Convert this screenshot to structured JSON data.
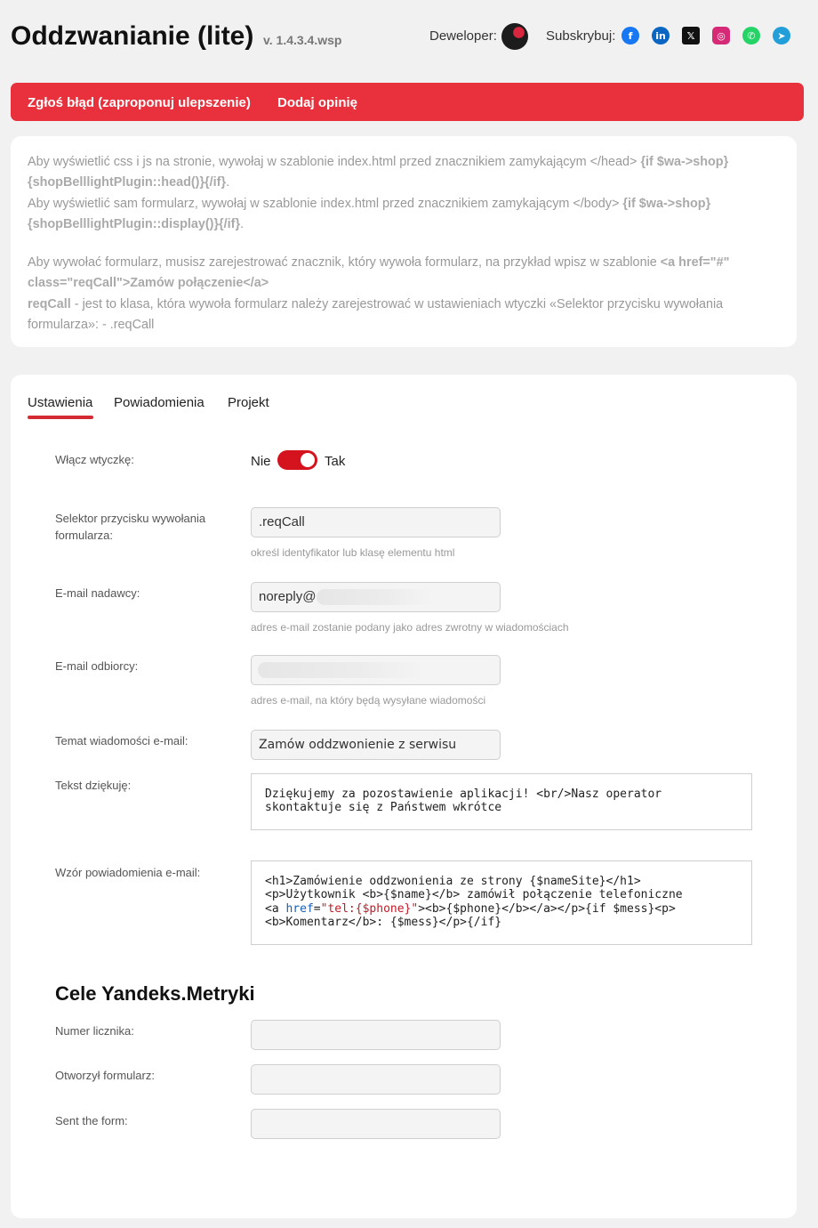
{
  "header": {
    "title": "Oddzwanianie (lite)",
    "version": "v. 1.4.3.4.wsp",
    "developer_label": "Deweloper:",
    "subscribe_label": "Subskrybuj:",
    "social": [
      {
        "name": "facebook-icon",
        "glyph": "f",
        "color": "#1877f2"
      },
      {
        "name": "linkedin-icon",
        "glyph": "in",
        "color": "#0a66c2"
      },
      {
        "name": "x-icon",
        "glyph": "𝕏",
        "color": "#111111"
      },
      {
        "name": "instagram-icon",
        "glyph": "◎",
        "color": "#d62976"
      },
      {
        "name": "whatsapp-icon",
        "glyph": "✆",
        "color": "#25d366"
      },
      {
        "name": "telegram-icon",
        "glyph": "➤",
        "color": "#229ed9"
      }
    ]
  },
  "actions": {
    "report_bug": "Zgłoś błąd (zaproponuj ulepszenie)",
    "add_review": "Dodaj opinię"
  },
  "info": {
    "line1_pre": "Aby wyświetlić css i js na stronie, wywołaj w szablonie index.html przed znacznikiem zamykającym </head> ",
    "line1_code": "{if $wa->shop}{shopBelllightPlugin::head()}{/if}",
    "line2_pre": "Aby wyświetlić sam formularz, wywołaj w szablonie index.html przed znacznikiem zamykającym </body> ",
    "line2_code": "{if $wa->shop}{shopBelllightPlugin::display()}{/if}",
    "line3_pre": "Aby wywołać formularz, musisz zarejestrować znacznik, który wywoła formularz, na przykład wpisz w szablonie ",
    "line3_code": "<a href=\"#\" class=\"reqCall\">Zamów połączenie</a>",
    "line4_code": "reqCall",
    "line4_post": " - jest to klasa, która wywoła formularz należy zarejestrować w ustawieniach wtyczki «Selektor przycisku wywołania formularza»: - .reqCall",
    "dot": "."
  },
  "tabs": [
    {
      "label": "Ustawienia",
      "active": true
    },
    {
      "label": "Powiadomienia",
      "active": false
    },
    {
      "label": "Projekt",
      "active": false
    }
  ],
  "form": {
    "enable_label": "Włącz wtyczkę:",
    "toggle_no": "Nie",
    "toggle_yes": "Tak",
    "selector_label": "Selektor przycisku wywołania formularza:",
    "selector_value": ".reqCall",
    "selector_hint": "określ identyfikator lub klasę elementu html",
    "sender_label": "E-mail nadawcy:",
    "sender_value": "noreply@",
    "sender_hint": "adres e-mail zostanie podany jako adres zwrotny w wiadomościach",
    "recipient_label": "E-mail odbiorcy:",
    "recipient_hint": "adres e-mail, na który będą wysyłane wiadomości",
    "subject_label": "Temat wiadomości e-mail:",
    "subject_value": "Zamów oddzwonienie z serwisu",
    "thanks_label": "Tekst dziękuję:",
    "thanks_value": "Dziękujemy za pozostawienie aplikacji! <br/>Nasz operator\nskontaktuje się z Państwem wkrótce",
    "template_label": "Wzór powiadomienia e-mail:",
    "template_l1": "<h1>Zamówienie oddzwonienia ze strony {$nameSite}</h1>",
    "template_l2": "<p>Użytkownik <b>{$name}</b> zamówił połączenie telefoniczne",
    "template_l3_a": "<a ",
    "template_l3_attr": "href",
    "template_l3_eq": "=",
    "template_l3_str": "\"tel:{$phone}\"",
    "template_l3_rest": "><b>{$phone}</b></a></p>{if $mess}<p>",
    "template_l4": "<b>Komentarz</b>: {$mess}</p>{/if}"
  },
  "metrics": {
    "title": "Cele Yandeks.Metryki",
    "counter_label": "Numer licznika:",
    "opened_label": "Otworzył formularz:",
    "sent_label": "Sent the form:"
  }
}
